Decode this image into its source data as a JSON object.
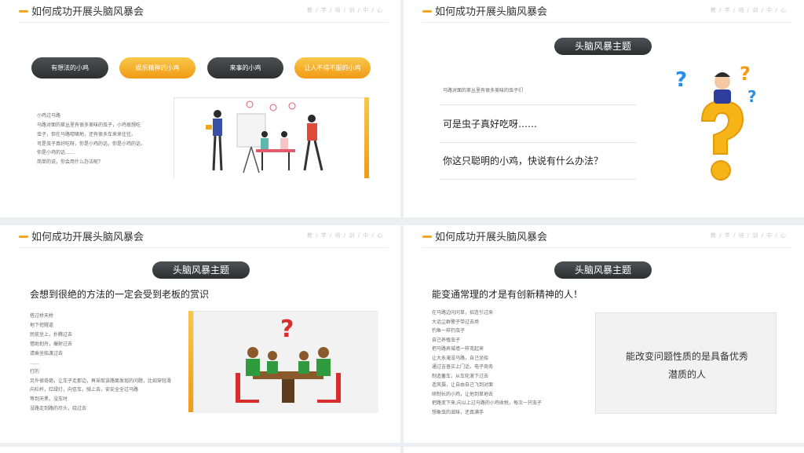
{
  "header": {
    "title": "如何成功开展头脑风暴会",
    "subtitle": "教 / 学 / 培 / 训 / 中 / 心"
  },
  "slide1": {
    "pills": [
      "有想法的小鸡",
      "娱乐精神的小鸡",
      "来事的小鸡",
      "让人不得不服的小鸡"
    ],
    "story_lines": [
      "小鸡过马路",
      "马路对面的草丛里有很多美味的虫子，小鸡很想吃",
      "虫子，但在马路唿啸地，还有很多车来来往往。",
      "可是虫子真好吃呀，你是小鸡的话，你是小鸡的话，",
      "你是小鸡的话……",
      "简单的说，你会用什么办法呢？"
    ]
  },
  "slide2": {
    "theme": "头脑风暴主题",
    "intro": "马路对面的草丛里有很多美味的虫子们",
    "line1": "可是虫子真好吃呀……",
    "line2": "你这只聪明的小鸡，快说有什么办法？"
  },
  "slide3": {
    "theme": "头脑风暴主题",
    "heading": "会想到很绝的方法的一定会受到老板的赏识",
    "lines": [
      "搭过桥天桥",
      "地下挖隧道",
      "民航坐上，扑腾过去",
      "借助划舟，爆射过去",
      "请乘坐船渡过去",
      "……",
      "打的",
      "另外很奇葩，让车子走那边，再采取该路面发现的问题，比如穿轻滑",
      "向栏杆，红绿灯，向信车，骑上去，安安全全过马路",
      "等到天黑，没车时",
      "没路走到路的尽头，绕过去"
    ]
  },
  "slide4": {
    "theme": "头脑风暴主题",
    "heading": "能变通常理的才是有创新精神的人！",
    "lines": [
      "在马路边问问草，招连引过来",
      "大话尘群警子带过去场",
      "钓鱼一样钓虫子",
      "自己养殖虫子",
      "把马路弄城墙一样弯起来",
      "让大永淹没马路，自己坐船",
      "通过吉普买上门话，电子商务",
      "制造蓄车，从车轮滚下过去",
      "造风摄，让自由自己飞到对面",
      "研制长的小鸡，让他到草地去",
      "把路变下来,向以上过马路的小鸡收税，每次一只虫子",
      "想象虫的滋味，还真满手"
    ],
    "quote": "能改变问题性质的是具备优秀潜质的人"
  }
}
